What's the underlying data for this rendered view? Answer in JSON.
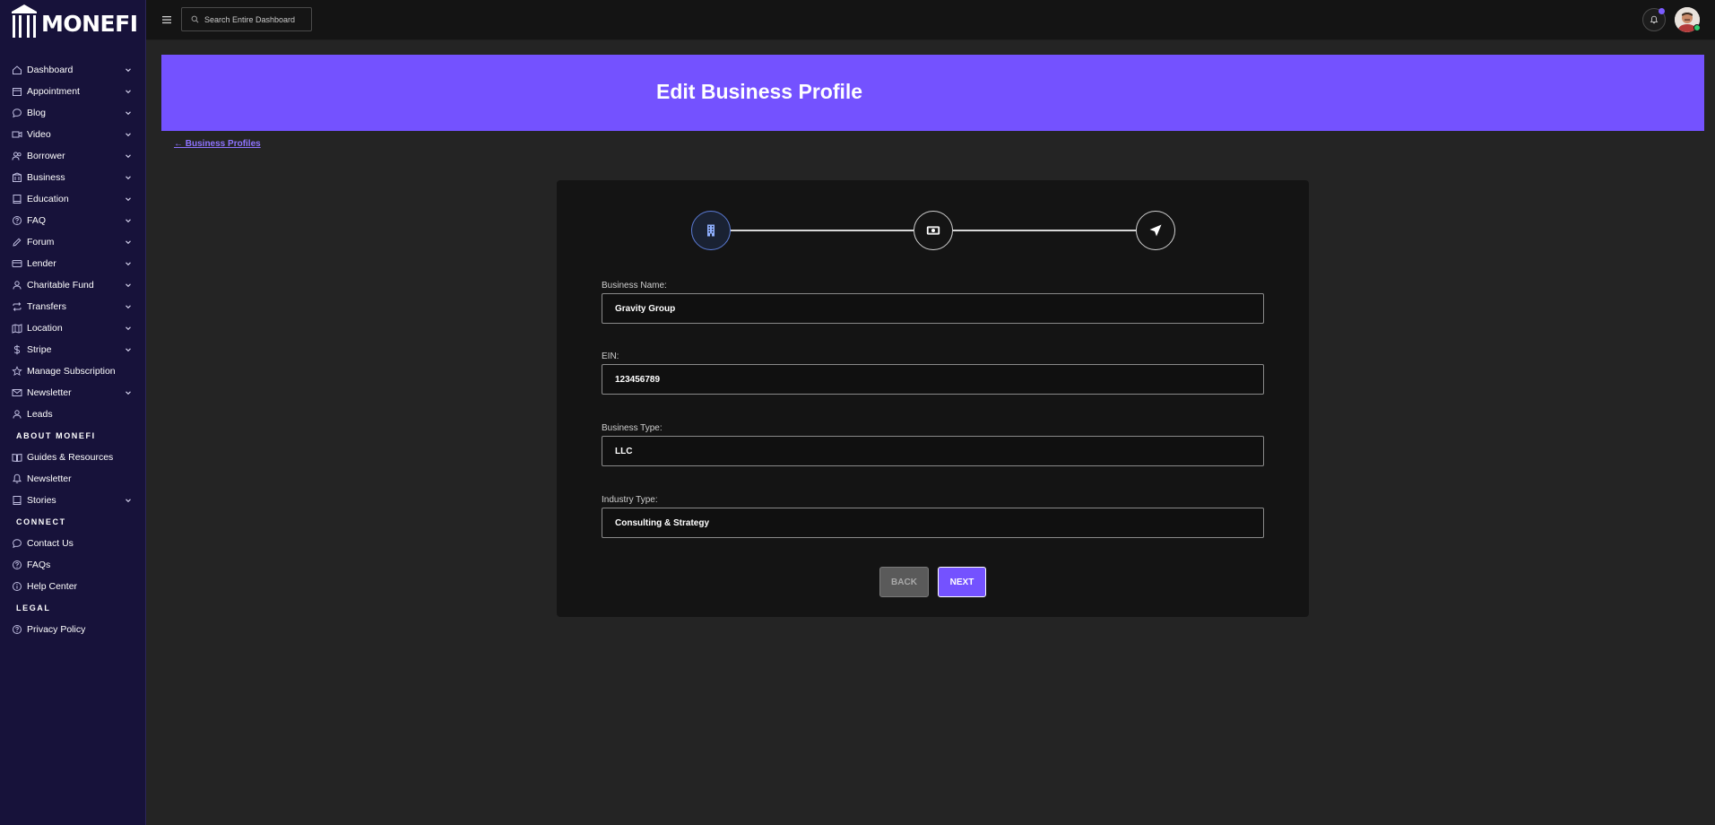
{
  "app": {
    "logo_text": "MONEFI"
  },
  "colors": {
    "sidebar_bg": "#17123a",
    "accent": "#7452ff",
    "page_bg": "#242424",
    "card_bg": "#141414"
  },
  "sidebar": {
    "items": [
      {
        "label": "Dashboard",
        "icon": "home-icon",
        "expandable": true
      },
      {
        "label": "Appointment",
        "icon": "calendar-icon",
        "expandable": true
      },
      {
        "label": "Blog",
        "icon": "chat-bubble-icon",
        "expandable": true
      },
      {
        "label": "Video",
        "icon": "video-icon",
        "expandable": true
      },
      {
        "label": "Borrower",
        "icon": "users-icon",
        "expandable": true
      },
      {
        "label": "Business",
        "icon": "building-icon",
        "expandable": true
      },
      {
        "label": "Education",
        "icon": "book-icon",
        "expandable": true
      },
      {
        "label": "FAQ",
        "icon": "help-circle-icon",
        "expandable": true
      },
      {
        "label": "Forum",
        "icon": "pen-icon",
        "expandable": true
      },
      {
        "label": "Lender",
        "icon": "credit-card-icon",
        "expandable": true
      },
      {
        "label": "Charitable Fund",
        "icon": "user-icon",
        "expandable": true
      },
      {
        "label": "Transfers",
        "icon": "repeat-icon",
        "expandable": true
      },
      {
        "label": "Location",
        "icon": "map-icon",
        "expandable": true
      },
      {
        "label": "Stripe",
        "icon": "dollar-icon",
        "expandable": true
      },
      {
        "label": "Manage Subscription",
        "icon": "star-icon",
        "expandable": false
      },
      {
        "label": "Newsletter",
        "icon": "mail-icon",
        "expandable": true
      },
      {
        "label": "Leads",
        "icon": "user-icon",
        "expandable": false
      }
    ],
    "sections": [
      {
        "title": "ABOUT MONEFI",
        "items": [
          {
            "label": "Guides & Resources",
            "icon": "book-open-icon",
            "expandable": false
          },
          {
            "label": "Newsletter",
            "icon": "bell-icon",
            "expandable": false
          },
          {
            "label": "Stories",
            "icon": "book-icon",
            "expandable": true
          }
        ]
      },
      {
        "title": "CONNECT",
        "items": [
          {
            "label": "Contact Us",
            "icon": "chat-bubble-icon",
            "expandable": false
          },
          {
            "label": "FAQs",
            "icon": "help-circle-icon",
            "expandable": false
          },
          {
            "label": "Help Center",
            "icon": "info-icon",
            "expandable": false
          }
        ]
      },
      {
        "title": "LEGAL",
        "items": [
          {
            "label": "Privacy Policy",
            "icon": "help-circle-icon",
            "expandable": false
          }
        ]
      }
    ]
  },
  "topbar": {
    "search_placeholder": "Search Entire Dashboard",
    "notification_dot": true
  },
  "page": {
    "title": "Edit Business Profile",
    "back_link": "← Business Profiles"
  },
  "stepper": {
    "steps": [
      {
        "icon": "building-icon",
        "active": true
      },
      {
        "icon": "cash-icon",
        "active": false
      },
      {
        "icon": "send-icon",
        "active": false
      }
    ]
  },
  "form": {
    "fields": [
      {
        "label": "Business Name:",
        "value": "Gravity Group"
      },
      {
        "label": "EIN:",
        "value": "123456789"
      },
      {
        "label": "Business Type:",
        "value": "LLC"
      },
      {
        "label": "Industry Type:",
        "value": "Consulting & Strategy"
      }
    ],
    "back_label": "BACK",
    "next_label": "NEXT"
  }
}
